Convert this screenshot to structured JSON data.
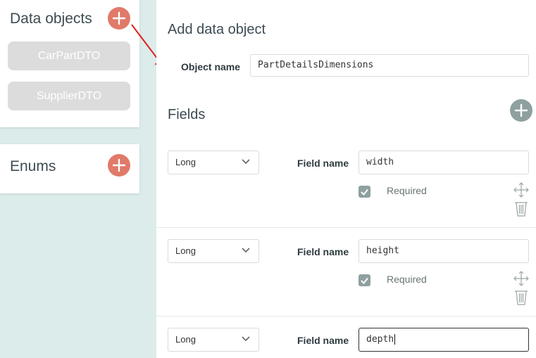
{
  "sidebar": {
    "data_objects": {
      "title": "Data objects",
      "add_icon": "plus-icon",
      "items": [
        {
          "label": "CarPartDTO"
        },
        {
          "label": "SupplierDTO"
        }
      ]
    },
    "enums": {
      "title": "Enums",
      "add_icon": "plus-icon"
    }
  },
  "main": {
    "title": "Add data object",
    "object_name_label": "Object name",
    "object_name_value": "PartDetailsDimensions",
    "fields_title": "Fields",
    "fields": [
      {
        "type": "Long",
        "name_label": "Field name",
        "name_value": "width",
        "required_label": "Required",
        "required": true
      },
      {
        "type": "Long",
        "name_label": "Field name",
        "name_value": "height",
        "required_label": "Required",
        "required": true
      },
      {
        "type": "Long",
        "name_label": "Field name",
        "name_value": "depth"
      }
    ]
  },
  "colors": {
    "accent_red": "#e07a69",
    "accent_grey": "#8ea0a0",
    "background": "#dcecea",
    "annotation_arrow": "#e02020"
  }
}
